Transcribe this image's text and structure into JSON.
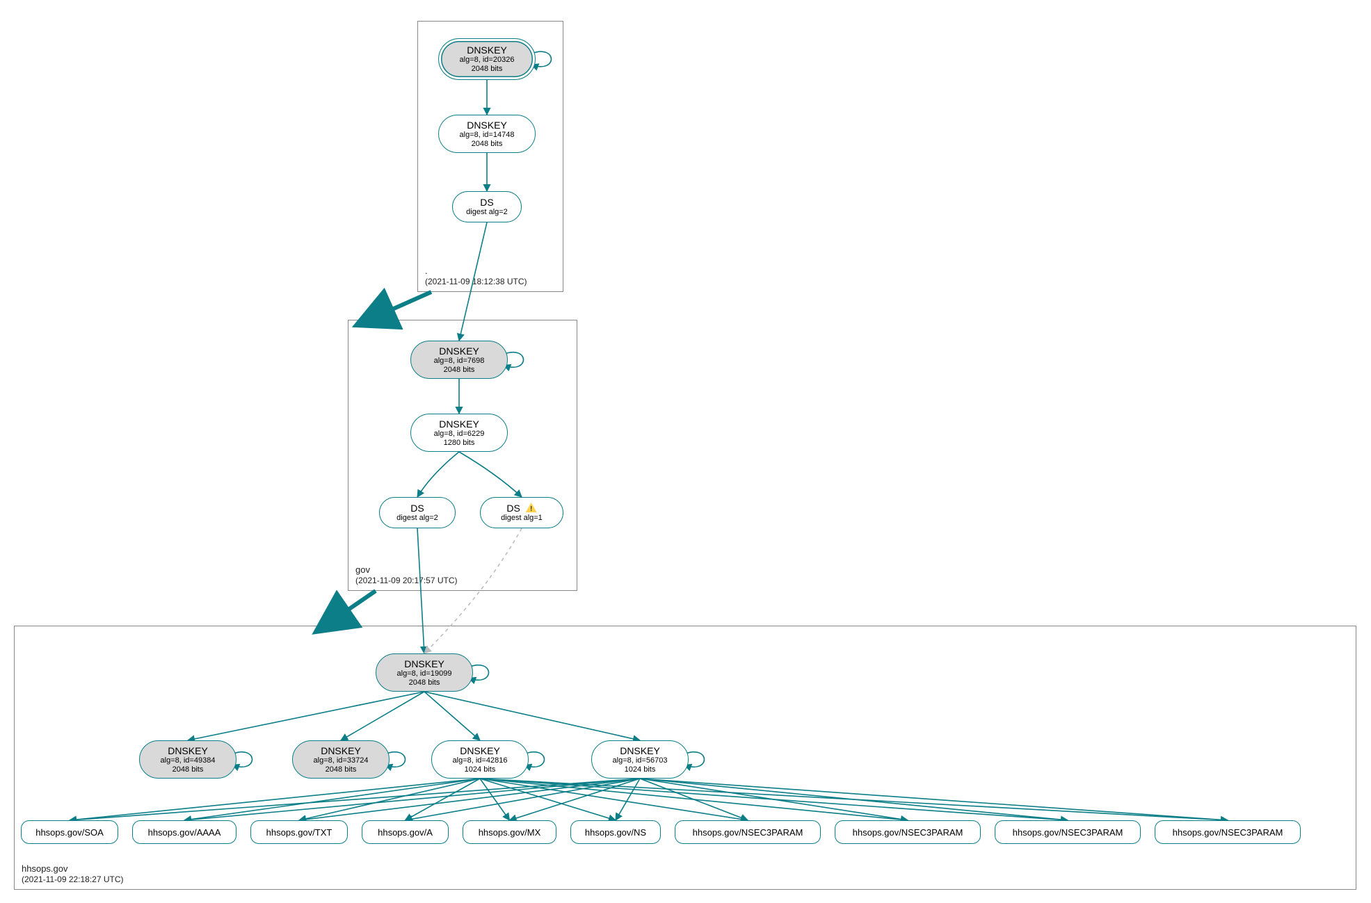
{
  "colors": {
    "stroke": "#0b7e88",
    "dashed": "#bdbdbd",
    "border": "#888888"
  },
  "zones": {
    "root": {
      "name": ".",
      "time": "(2021-11-09 18:12:38 UTC)"
    },
    "gov": {
      "name": "gov",
      "time": "(2021-11-09 20:17:57 UTC)"
    },
    "hhsops": {
      "name": "hhsops.gov",
      "time": "(2021-11-09 22:18:27 UTC)"
    }
  },
  "nodes": {
    "root_ksk": {
      "t1": "DNSKEY",
      "t2": "alg=8, id=20326",
      "t3": "2048 bits"
    },
    "root_zsk": {
      "t1": "DNSKEY",
      "t2": "alg=8, id=14748",
      "t3": "2048 bits"
    },
    "root_ds": {
      "t1": "DS",
      "t2": "digest alg=2"
    },
    "gov_ksk": {
      "t1": "DNSKEY",
      "t2": "alg=8, id=7698",
      "t3": "2048 bits"
    },
    "gov_zsk": {
      "t1": "DNSKEY",
      "t2": "alg=8, id=6229",
      "t3": "1280 bits"
    },
    "gov_ds1": {
      "t1": "DS",
      "t2": "digest alg=2"
    },
    "gov_ds2": {
      "t1": "DS",
      "t2": "digest alg=1",
      "warn": true
    },
    "h_ksk": {
      "t1": "DNSKEY",
      "t2": "alg=8, id=19099",
      "t3": "2048 bits"
    },
    "h_k49384": {
      "t1": "DNSKEY",
      "t2": "alg=8, id=49384",
      "t3": "2048 bits"
    },
    "h_k33724": {
      "t1": "DNSKEY",
      "t2": "alg=8, id=33724",
      "t3": "2048 bits"
    },
    "h_k42816": {
      "t1": "DNSKEY",
      "t2": "alg=8, id=42816",
      "t3": "1024 bits"
    },
    "h_k56703": {
      "t1": "DNSKEY",
      "t2": "alg=8, id=56703",
      "t3": "1024 bits"
    }
  },
  "rrsets": {
    "soa": {
      "label": "hhsops.gov/SOA"
    },
    "aaaa": {
      "label": "hhsops.gov/AAAA"
    },
    "txt": {
      "label": "hhsops.gov/TXT"
    },
    "a": {
      "label": "hhsops.gov/A"
    },
    "mx": {
      "label": "hhsops.gov/MX"
    },
    "ns": {
      "label": "hhsops.gov/NS"
    },
    "n1": {
      "label": "hhsops.gov/NSEC3PARAM"
    },
    "n2": {
      "label": "hhsops.gov/NSEC3PARAM"
    },
    "n3": {
      "label": "hhsops.gov/NSEC3PARAM"
    },
    "n4": {
      "label": "hhsops.gov/NSEC3PARAM"
    }
  }
}
